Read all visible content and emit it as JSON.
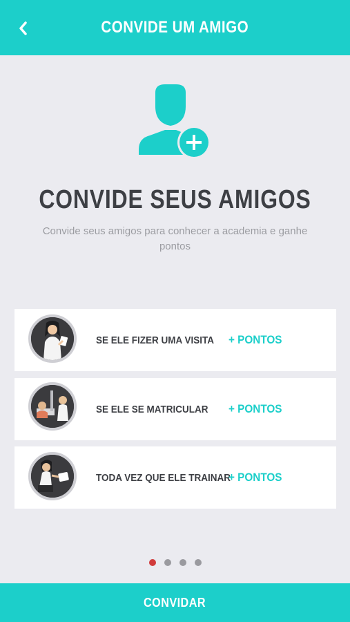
{
  "header": {
    "title": "CONVIDE UM AMIGO",
    "back_icon": "chevron-left-icon"
  },
  "hero": {
    "icon": "add-user-icon",
    "title": "CONVIDE SEUS AMIGOS",
    "subtitle": "Convide seus amigos para conhecer a academia e ganhe pontos"
  },
  "rewards": [
    {
      "label": "SE ELE FIZER UMA VISITA",
      "points": "+ PONTOS",
      "illustration": "woman-with-card"
    },
    {
      "label": "SE ELE SE MATRICULAR",
      "points": "+ PONTOS",
      "illustration": "gym-signup"
    },
    {
      "label": "TODA VEZ QUE ELE TRAINAR",
      "points": "+ PONTOS",
      "illustration": "woman-training"
    }
  ],
  "pagination": {
    "total": 4,
    "active": 1
  },
  "footer": {
    "button_label": "CONVIDAR"
  },
  "colors": {
    "accent": "#1ccfca",
    "background": "#ebebf0",
    "text_dark": "#3d3f44",
    "text_muted": "#9b9ca1",
    "dot_active": "#d13b3b",
    "dot_inactive": "#9a9a9f"
  }
}
